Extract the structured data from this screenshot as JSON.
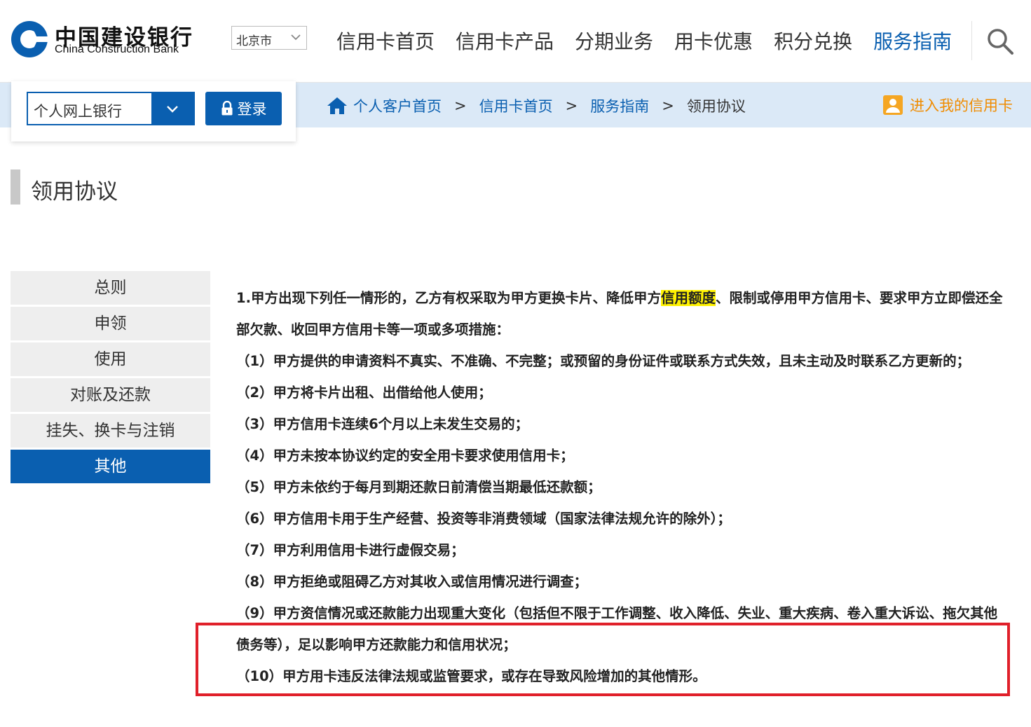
{
  "header": {
    "logo_cn": "中国建设银行",
    "logo_en": "China Construction Bank",
    "city": "北京市",
    "nav": [
      {
        "label": "信用卡首页"
      },
      {
        "label": "信用卡产品"
      },
      {
        "label": "分期业务"
      },
      {
        "label": "用卡优惠"
      },
      {
        "label": "积分兑换"
      },
      {
        "label": "服务指南",
        "active": true
      }
    ],
    "search_icon": "search-icon",
    "accent_color": "#0a5fb0"
  },
  "login": {
    "bank_select": "个人网上银行",
    "login_label": "登录"
  },
  "breadcrumb": {
    "items": [
      "个人客户首页",
      "信用卡首页",
      "服务指南",
      "领用协议"
    ],
    "separator": ">"
  },
  "my_card": "进入我的信用卡",
  "page_title": "领用协议",
  "side_menu": [
    {
      "label": "总则"
    },
    {
      "label": "申领"
    },
    {
      "label": "使用"
    },
    {
      "label": "对账及还款"
    },
    {
      "label": "挂失、换卡与注销"
    },
    {
      "label": "其他",
      "active": true
    }
  ],
  "content": {
    "intro_before": "1.甲方出现下列任一情形的，乙方有权采取为甲方更换卡片、降低甲方",
    "intro_highlight": "信用额度",
    "intro_after": "、限制或停用甲方信用卡、要求甲方立即偿还全部欠款、收回甲方信用卡等一项或多项措施：",
    "items": [
      "（1）甲方提供的申请资料不真实、不准确、不完整；或预留的身份证件或联系方式失效，且未主动及时联系乙方更新的；",
      "（2）甲方将卡片出租、出借给他人使用；",
      "（3）甲方信用卡连续6个月以上未发生交易的；",
      "（4）甲方未按本协议约定的安全用卡要求使用信用卡；",
      "（5）甲方未依约于每月到期还款日前清偿当期最低还款额；",
      "（6）甲方信用卡用于生产经营、投资等非消费领域（国家法律法规允许的除外）；",
      "（7）甲方利用信用卡进行虚假交易；",
      "（8）甲方拒绝或阻碍乙方对其收入或信用情况进行调查；",
      "（9）甲方资信情况或还款能力出现重大变化（包括但不限于工作调整、收入降低、失业、重大疾病、卷入重大诉讼、拖欠其他债务等），足以影响甲方还款能力和信用状况；",
      "（10）甲方用卡违反法律法规或监管要求，或存在导致风险增加的其他情形。"
    ]
  }
}
